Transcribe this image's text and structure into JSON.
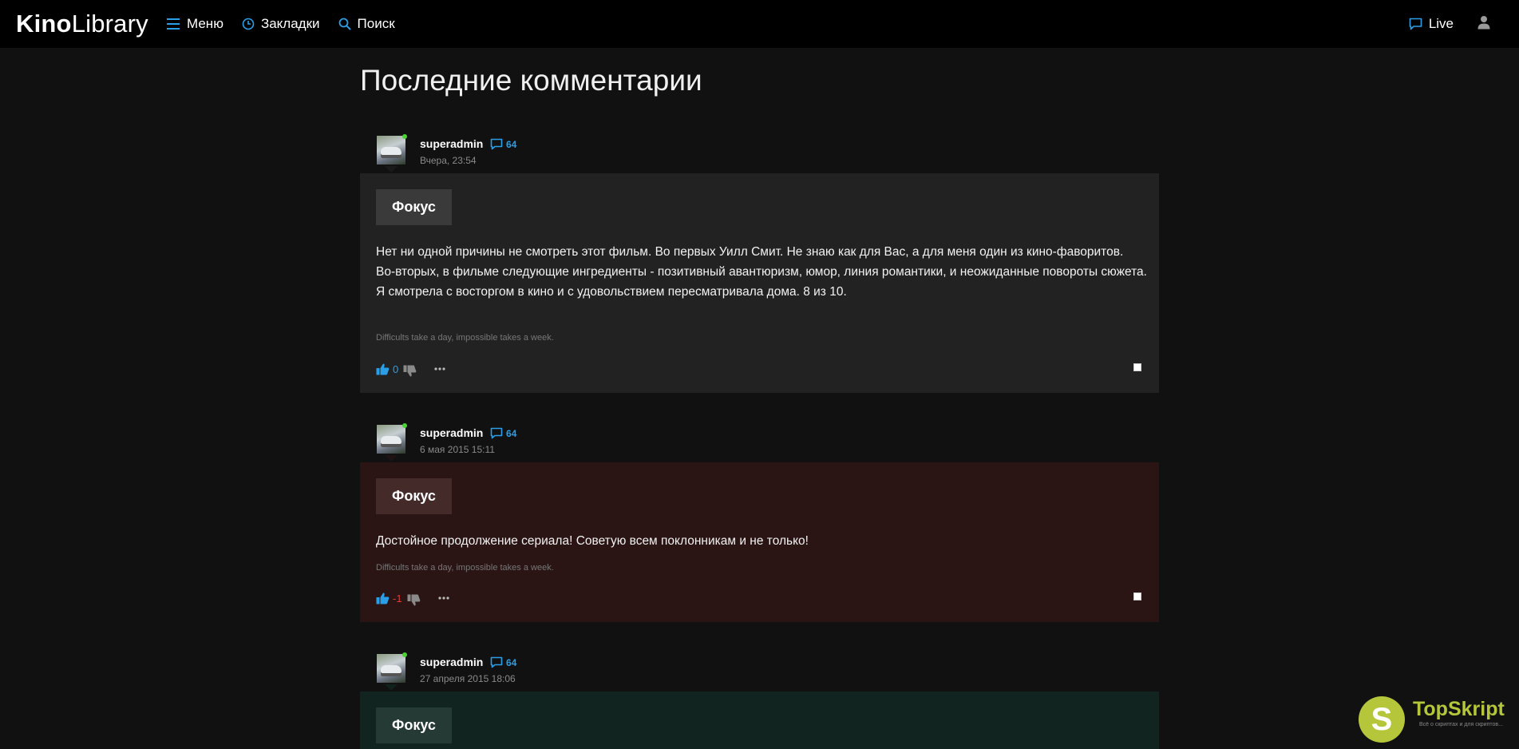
{
  "header": {
    "logo_bold": "Kino",
    "logo_light": "Library",
    "nav": [
      {
        "label": "Меню",
        "icon": "menu-icon"
      },
      {
        "label": "Закладки",
        "icon": "clock-icon"
      },
      {
        "label": "Поиск",
        "icon": "search-icon"
      }
    ],
    "live_label": "Live"
  },
  "page": {
    "title": "Последние комментарии"
  },
  "colors": {
    "accent": "#2a9fe8",
    "negative": "#e53935",
    "online": "#4cd137"
  },
  "comments": [
    {
      "user": "superadmin",
      "count": "64",
      "date": "Вчера, 23:54",
      "movie": "Фокус",
      "lines": [
        "Нет ни одной причины не смотреть этот фильм. Во первых Уилл Смит. Не знаю как для Вас, а для меня один из кино-фаворитов.",
        "Во-вторых, в фильме следующие ингредиенты - позитивный авантюризм, юмор, линия романтики, и неожиданные повороты сюжета.",
        "Я смотрела с восторгом в кино и с удовольствием пересматривала дома. 8 из 10."
      ],
      "signature": "Difficults take a day, impossible takes a week.",
      "rating": "0"
    },
    {
      "user": "superadmin",
      "count": "64",
      "date": "6 мая 2015 15:11",
      "movie": "Фокус",
      "lines": [
        "Достойное продолжение сериала! Советую всем поклонникам и не только!"
      ],
      "signature": "Difficults take a day, impossible takes a week.",
      "rating": "-1"
    },
    {
      "user": "superadmin",
      "count": "64",
      "date": "27 апреля 2015 18:06",
      "movie": "Фокус"
    }
  ],
  "badge": {
    "letter": "S",
    "name": "TopSkript",
    "tagline": "Всё о скриптах и для скриптов..."
  }
}
